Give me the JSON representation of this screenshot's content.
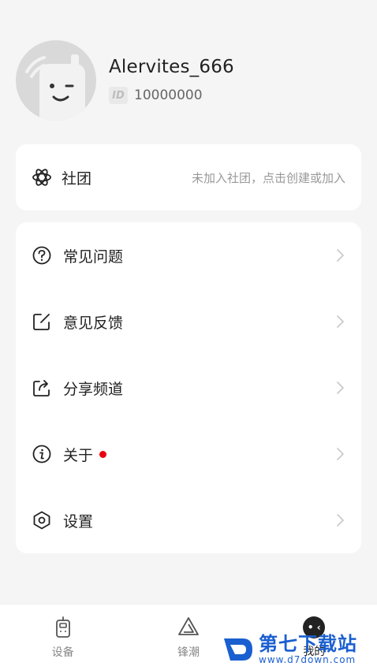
{
  "profile": {
    "username": "Alervites_666",
    "id_badge": "ID",
    "user_id": "10000000"
  },
  "club": {
    "label": "社团",
    "hint": "未加入社团，点击创建或加入"
  },
  "menu": {
    "items": [
      {
        "label": "常见问题",
        "icon": "question-circle-icon"
      },
      {
        "label": "意见反馈",
        "icon": "edit-note-icon"
      },
      {
        "label": "分享频道",
        "icon": "share-icon"
      },
      {
        "label": "关于",
        "icon": "info-circle-icon",
        "has_red_dot": true
      },
      {
        "label": "设置",
        "icon": "settings-hexagon-icon"
      }
    ]
  },
  "tabbar": {
    "tabs": [
      {
        "label": "设备",
        "icon": "walkie-talkie-icon"
      },
      {
        "label": "锋潮",
        "icon": "triangle-logo-icon"
      },
      {
        "label": "我的",
        "icon": "profile-face-icon",
        "active": true
      }
    ]
  },
  "watermark": {
    "title": "第七下载站",
    "url": "www.d7down.com"
  },
  "colors": {
    "accent_red": "#e60012",
    "background": "#f5f5f5",
    "card": "#ffffff",
    "watermark_blue": "#1a5fd0"
  }
}
